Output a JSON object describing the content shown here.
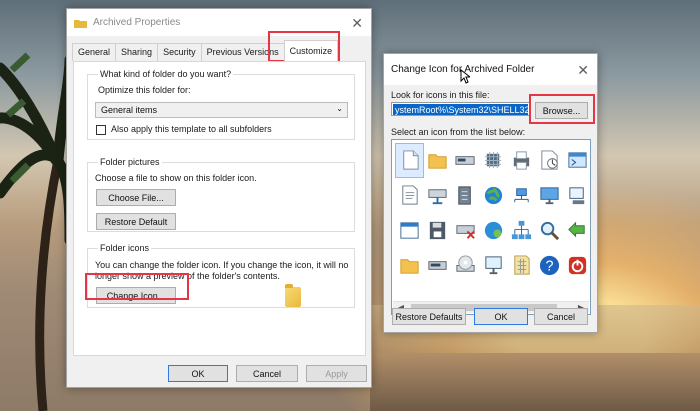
{
  "properties": {
    "title": "Archived Properties",
    "tabs": [
      "General",
      "Sharing",
      "Security",
      "Previous Versions",
      "Customize"
    ],
    "active_tab": "Customize",
    "section_1": {
      "legend": "What kind of folder do you want?",
      "optimize_label": "Optimize this folder for:",
      "optimize_value": "General items",
      "checkbox_label": "Also apply this template to all subfolders"
    },
    "section_2": {
      "legend": "Folder pictures",
      "instruction": "Choose a file to show on this folder icon.",
      "choose_button": "Choose File...",
      "restore_button": "Restore Default"
    },
    "section_3": {
      "legend": "Folder icons",
      "description_line_1": "You can change the folder icon. If you change the icon, it will no",
      "description_line_2": "longer show a preview of the folder's contents.",
      "change_button": "Change Icon..."
    },
    "buttons": {
      "ok": "OK",
      "cancel": "Cancel",
      "apply": "Apply"
    }
  },
  "change_icon": {
    "title": "Change Icon for Archived Folder",
    "file_label": "Look for icons in this file:",
    "file_value": "ystemRoot%\\System32\\SHELL32.dll",
    "browse_button": "Browse...",
    "list_label": "Select an icon from the list below:",
    "restore_button": "Restore Defaults",
    "ok_button": "OK",
    "cancel_button": "Cancel"
  },
  "icons": [
    {
      "name": "blank-document-icon",
      "kind": "doc"
    },
    {
      "name": "folder-icon",
      "kind": "folder"
    },
    {
      "name": "removable-drive-icon",
      "kind": "drive"
    },
    {
      "name": "chip-icon",
      "kind": "chip"
    },
    {
      "name": "printer-icon",
      "kind": "printer"
    },
    {
      "name": "clock-document-icon",
      "kind": "clock"
    },
    {
      "name": "terminal-window-icon",
      "kind": "window"
    },
    {
      "name": "text-document-icon",
      "kind": "text"
    },
    {
      "name": "network-drive-icon",
      "kind": "netdrive"
    },
    {
      "name": "server-icon",
      "kind": "server"
    },
    {
      "name": "globe-icon",
      "kind": "globe"
    },
    {
      "name": "network-icon",
      "kind": "network"
    },
    {
      "name": "display-icon",
      "kind": "display"
    },
    {
      "name": "computer-icon",
      "kind": "computer"
    },
    {
      "name": "application-window-icon",
      "kind": "app"
    },
    {
      "name": "disk-floppy-icon",
      "kind": "floppy"
    },
    {
      "name": "disconnected-drive-icon",
      "kind": "xdrive"
    },
    {
      "name": "world-network-icon",
      "kind": "world"
    },
    {
      "name": "network-tree-icon",
      "kind": "tree"
    },
    {
      "name": "search-icon",
      "kind": "search"
    },
    {
      "name": "arrow-icon",
      "kind": "arrow"
    },
    {
      "name": "folder-open-icon",
      "kind": "folder"
    },
    {
      "name": "hard-drive-icon",
      "kind": "hdd"
    },
    {
      "name": "cd-drive-icon",
      "kind": "cd"
    },
    {
      "name": "monitor-icon",
      "kind": "monitor"
    },
    {
      "name": "grid-document-icon",
      "kind": "grid"
    },
    {
      "name": "help-icon",
      "kind": "help"
    },
    {
      "name": "power-icon",
      "kind": "power"
    }
  ],
  "colors": {
    "highlight": "#e63543",
    "selection": "#0a66c6",
    "help_blue": "#1d63bd",
    "power_red": "#d13224"
  }
}
